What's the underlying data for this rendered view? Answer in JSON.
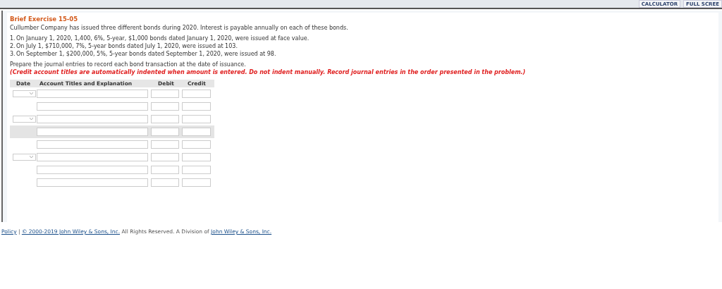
{
  "toolbar": {
    "buttons": [
      "CALCULATOR",
      "FULL SCREE"
    ]
  },
  "exercise": {
    "title": "Brief Exercise 15-05",
    "intro": "Cullumber Company has issued three different bonds during 2020. Interest is payable annually on each of these bonds.",
    "items": [
      "On January 1, 2020, 1,400, 6%, 5-year, $1,000 bonds dated January 1, 2020, were issued at face value.",
      "On July 1, $710,000, 7%, 5-year bonds dated July 1, 2020, were issued at 103.",
      "On September 1, $200,000, 5%, 5-year bonds dated September 1, 2020, were issued at 98."
    ],
    "item_numbers": [
      "1.",
      "2.",
      "3."
    ],
    "instruction": "Prepare the journal entries to record each bond transaction at the date of issuance.",
    "note": "(Credit account titles are automatically indented when amount is entered. Do not indent manually. Record journal entries in the order presented in the problem.)"
  },
  "journal": {
    "columns": [
      "Date",
      "Account Titles and Explanation",
      "Debit",
      "Credit"
    ],
    "rows": [
      {
        "has_date": true,
        "highlighted": false
      },
      {
        "has_date": false,
        "highlighted": false
      },
      {
        "has_date": true,
        "highlighted": false
      },
      {
        "has_date": false,
        "highlighted": true
      },
      {
        "has_date": false,
        "highlighted": false
      },
      {
        "has_date": true,
        "highlighted": false
      },
      {
        "has_date": false,
        "highlighted": false
      },
      {
        "has_date": false,
        "highlighted": false
      }
    ]
  },
  "footer": {
    "links": [
      "Policy",
      "© 2000-2019 John Wiley & Sons, Inc.",
      "John Wiley & Sons, Inc."
    ],
    "separator": "|",
    "text": "All Rights Reserved. A Division of"
  }
}
